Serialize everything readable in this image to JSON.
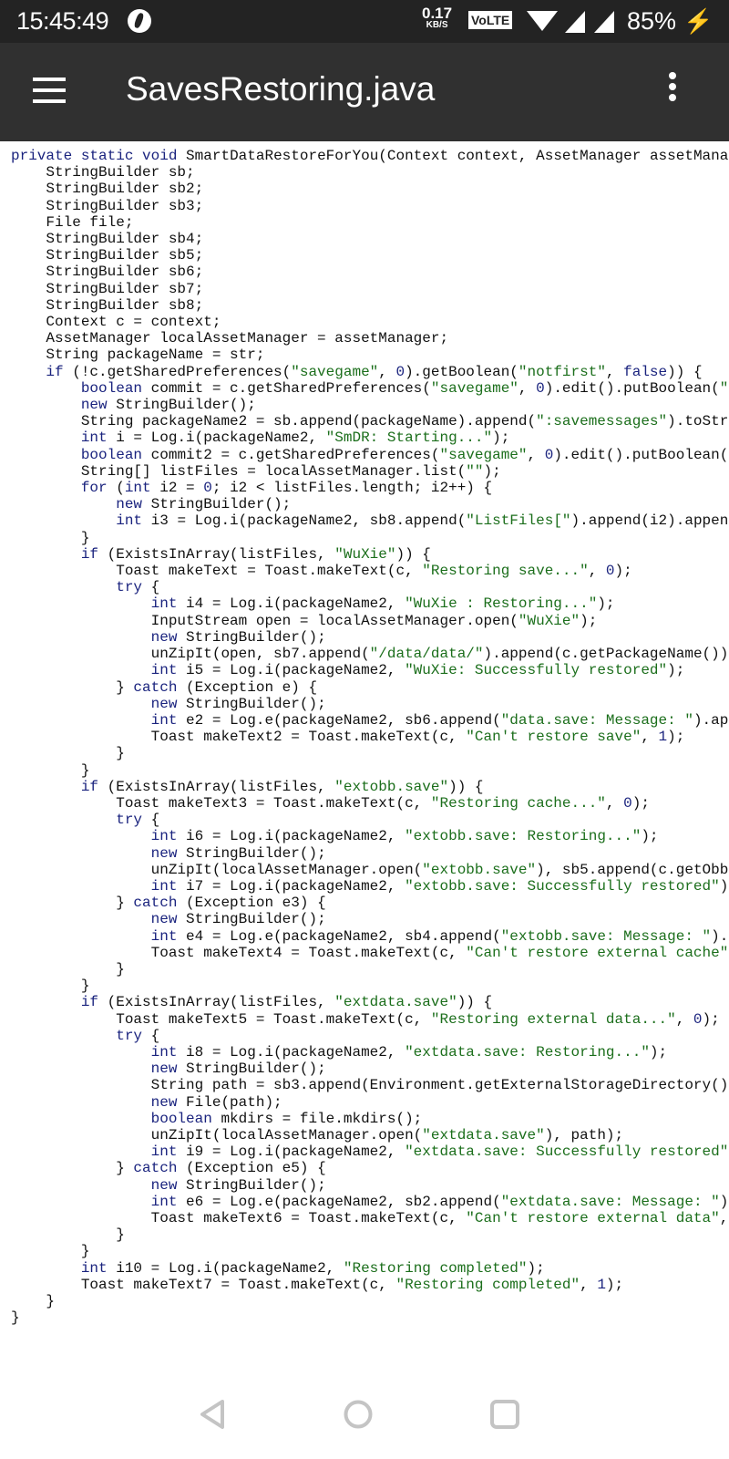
{
  "status_bar": {
    "time": "15:45:49",
    "net_speed_value": "0.17",
    "net_speed_unit": "KB/S",
    "volte": "VoLTE",
    "battery": "85%",
    "icons": [
      "globe-icon",
      "wifi-icon",
      "signal-icon",
      "signal-icon",
      "charging-icon"
    ]
  },
  "app_bar": {
    "title": "SavesRestoring.java",
    "menu_icon": "hamburger-icon",
    "overflow_icon": "more-vert-icon"
  },
  "syntax_colors": {
    "keyword": "#1a237e",
    "string": "#1b6e1b",
    "number": "#1a237e",
    "plain": "#111111"
  },
  "code_lines": [
    "private static void SmartDataRestoreForYou(Context context, AssetManager assetMana",
    "    StringBuilder sb;",
    "    StringBuilder sb2;",
    "    StringBuilder sb3;",
    "    File file;",
    "    StringBuilder sb4;",
    "    StringBuilder sb5;",
    "    StringBuilder sb6;",
    "    StringBuilder sb7;",
    "    StringBuilder sb8;",
    "    Context c = context;",
    "    AssetManager localAssetManager = assetManager;",
    "    String packageName = str;",
    "    if (!c.getSharedPreferences(\"savegame\", 0).getBoolean(\"notfirst\", false)) {",
    "        boolean commit = c.getSharedPreferences(\"savegame\", 0).edit().putBoolean(\"",
    "        new StringBuilder();",
    "        String packageName2 = sb.append(packageName).append(\":savemessages\").toStr",
    "        int i = Log.i(packageName2, \"SmDR: Starting...\");",
    "        boolean commit2 = c.getSharedPreferences(\"savegame\", 0).edit().putBoolean(",
    "        String[] listFiles = localAssetManager.list(\"\");",
    "        for (int i2 = 0; i2 < listFiles.length; i2++) {",
    "            new StringBuilder();",
    "            int i3 = Log.i(packageName2, sb8.append(\"ListFiles[\").append(i2).appen",
    "        }",
    "        if (ExistsInArray(listFiles, \"WuXie\")) {",
    "            Toast makeText = Toast.makeText(c, \"Restoring save...\", 0);",
    "            try {",
    "                int i4 = Log.i(packageName2, \"WuXie : Restoring...\");",
    "                InputStream open = localAssetManager.open(\"WuXie\");",
    "                new StringBuilder();",
    "                unZipIt(open, sb7.append(\"/data/data/\").append(c.getPackageName())",
    "                int i5 = Log.i(packageName2, \"WuXie: Successfully restored\");",
    "            } catch (Exception e) {",
    "                new StringBuilder();",
    "                int e2 = Log.e(packageName2, sb6.append(\"data.save: Message: \").ap",
    "                Toast makeText2 = Toast.makeText(c, \"Can't restore save\", 1);",
    "            }",
    "        }",
    "        if (ExistsInArray(listFiles, \"extobb.save\")) {",
    "            Toast makeText3 = Toast.makeText(c, \"Restoring cache...\", 0);",
    "            try {",
    "                int i6 = Log.i(packageName2, \"extobb.save: Restoring...\");",
    "                new StringBuilder();",
    "                unZipIt(localAssetManager.open(\"extobb.save\"), sb5.append(c.getObb",
    "                int i7 = Log.i(packageName2, \"extobb.save: Successfully restored\")",
    "            } catch (Exception e3) {",
    "                new StringBuilder();",
    "                int e4 = Log.e(packageName2, sb4.append(\"extobb.save: Message: \").",
    "                Toast makeText4 = Toast.makeText(c, \"Can't restore external cache\"",
    "            }",
    "        }",
    "        if (ExistsInArray(listFiles, \"extdata.save\")) {",
    "            Toast makeText5 = Toast.makeText(c, \"Restoring external data...\", 0);",
    "            try {",
    "                int i8 = Log.i(packageName2, \"extdata.save: Restoring...\");",
    "                new StringBuilder();",
    "                String path = sb3.append(Environment.getExternalStorageDirectory()",
    "                new File(path);",
    "                boolean mkdirs = file.mkdirs();",
    "                unZipIt(localAssetManager.open(\"extdata.save\"), path);",
    "                int i9 = Log.i(packageName2, \"extdata.save: Successfully restored\"",
    "            } catch (Exception e5) {",
    "                new StringBuilder();",
    "                int e6 = Log.e(packageName2, sb2.append(\"extdata.save: Message: \")",
    "                Toast makeText6 = Toast.makeText(c, \"Can't restore external data\",",
    "            }",
    "        }",
    "        int i10 = Log.i(packageName2, \"Restoring completed\");",
    "        Toast makeText7 = Toast.makeText(c, \"Restoring completed\", 1);",
    "    }",
    "}"
  ],
  "nav_bar": {
    "icons": [
      "back-icon",
      "home-icon",
      "recents-icon"
    ]
  }
}
